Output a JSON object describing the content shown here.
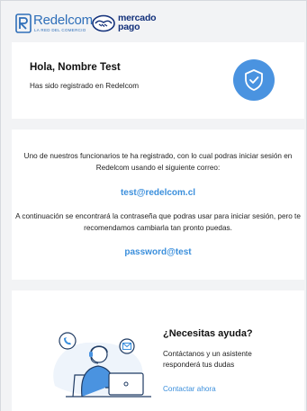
{
  "header": {
    "redelcom_logo_word": "Redelcom",
    "redelcom_logo_tagline": "LA RED DEL COMERCIO",
    "mercadopago_logo_line1": "mercado",
    "mercadopago_logo_line2": "pago"
  },
  "greeting": {
    "title": "Hola, Nombre Test",
    "subtitle": "Has sido registrado en Redelcom",
    "icon": "shield-check-icon"
  },
  "info": {
    "paragraph1": "Uno de nuestros funcionarios te ha registrado, con lo cual podras iniciar sesión en Redelcom usando el siguiente correo:",
    "email": "test@redelcom.cl",
    "paragraph2": "A continuación se encontrará la contraseña que podras usar para iniciar sesión, pero te recomendamos cambiarla tan pronto puedas.",
    "password": "password@test"
  },
  "help": {
    "title": "¿Necesitas ayuda?",
    "text": "Contáctanos y un asistente responderá tus dudas",
    "link": "Contactar ahora",
    "illustration": "support-agent-illustration"
  },
  "colors": {
    "background": "#f2f3f5",
    "card": "#ffffff",
    "accent": "#3b8fdc",
    "badge": "#4a93e0",
    "brand_redelcom": "#2f6fb9",
    "brand_mercadopago": "#12307a"
  }
}
